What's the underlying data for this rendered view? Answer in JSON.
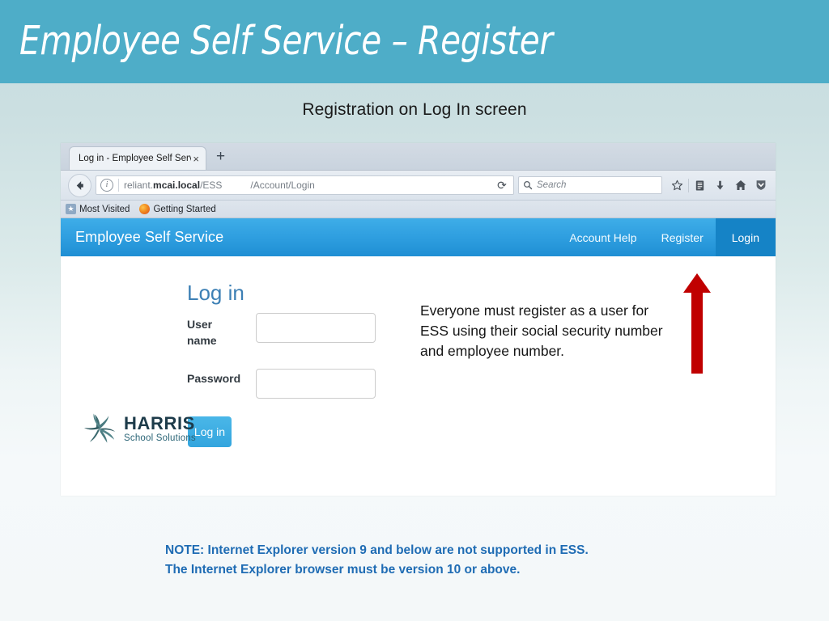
{
  "slide": {
    "title": "Employee Self Service – Register",
    "subtitle": "Registration on Log In screen",
    "banner_color": "#4eadc8"
  },
  "browser": {
    "tab": {
      "title": "Log in - Employee Self Service",
      "close_label": "×",
      "new_tab_label": "+"
    },
    "address_bar": {
      "url_host": "reliant.",
      "url_domain": "mcai.local",
      "url_suffix": "/ESS",
      "url_path": "/Account/Login",
      "info_icon_label": "i",
      "reload_icon": "⟳"
    },
    "search": {
      "placeholder": "Search"
    },
    "toolbar_icons": [
      "bookmark-star-icon",
      "reading-list-icon",
      "downloads-icon",
      "home-icon",
      "sync-shield-icon"
    ],
    "bookmarks": [
      {
        "label": "Most Visited",
        "icon": "bookmark-icon"
      },
      {
        "label": "Getting Started",
        "icon": "firefox-icon"
      }
    ]
  },
  "ess": {
    "brand": "Employee Self Service",
    "nav_links": [
      {
        "label": "Account Help",
        "active": false
      },
      {
        "label": "Register",
        "active": false
      },
      {
        "label": "Login",
        "active": true
      }
    ],
    "form": {
      "heading": "Log in",
      "username_label": "User name",
      "username_value": "",
      "password_label": "Password",
      "password_value": "",
      "submit_label": "Log in"
    },
    "logo": {
      "name": "HARRIS",
      "tagline": "School Solutions"
    },
    "colors": {
      "navbar": "#2f9fe0",
      "navbar_active": "#1583c6",
      "heading": "#3d80b5",
      "button": "#33a5de"
    }
  },
  "annotations": {
    "callout_text": "Everyone must register as a user for ESS using their social security number and employee number.",
    "arrow_color": "#c00000",
    "arrow_direction": "up",
    "note_text": "NOTE:  Internet Explorer version 9 and below are not supported in ESS.\nThe Internet Explorer browser must be version 10 or above.",
    "note_color": "#1f6cb4"
  }
}
